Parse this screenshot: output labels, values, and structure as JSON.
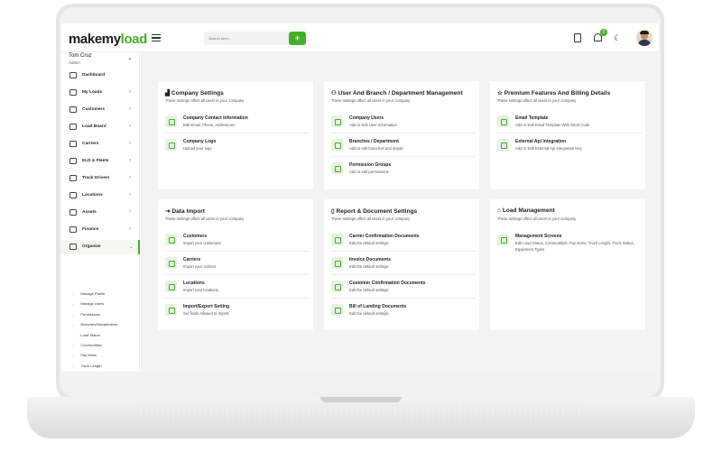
{
  "topbar": {
    "logo_main": "makemy",
    "logo_accent": "load",
    "search_placeholder": "Search here...",
    "search_button": "+",
    "notification_count": "0"
  },
  "user": {
    "name": "Tom Cruz",
    "role": "Admin"
  },
  "nav": [
    {
      "label": "Dashboard",
      "icon": "dashboard-icon"
    },
    {
      "label": "My Loads",
      "icon": "truck-icon"
    },
    {
      "label": "Customers",
      "icon": "users-icon"
    },
    {
      "label": "Load Board",
      "icon": "chart-icon"
    },
    {
      "label": "Carriers",
      "icon": "truck-icon"
    },
    {
      "label": "ELD & Fleets",
      "icon": "fleet-icon"
    },
    {
      "label": "Track Drivers",
      "icon": "pin-icon"
    },
    {
      "label": "Locations",
      "icon": "location-icon"
    },
    {
      "label": "Assets",
      "icon": "box-icon"
    },
    {
      "label": "Finance",
      "icon": "finance-icon"
    },
    {
      "label": "Organize",
      "icon": "gear-icon"
    }
  ],
  "subnav": [
    "Manage Profile",
    "Manage Users",
    "Permissions",
    "Branches/Departments",
    "Load Status",
    "Commodities",
    "Pay Items",
    "Truck Length",
    "Truck Status",
    "Equipment Types"
  ],
  "cards": [
    {
      "title": "Company Settings",
      "subtitle": "These settings affect all users in your company",
      "rows": [
        {
          "title": "Company Contact Information",
          "desc": "Edit Email, Phone, Address etc."
        },
        {
          "title": "Company Logo",
          "desc": "Upload your logo"
        }
      ]
    },
    {
      "title": "User And Branch / Department Management",
      "subtitle": "These settings affect all users in your company",
      "rows": [
        {
          "title": "Company Users",
          "desc": "Add or Edit User Information"
        },
        {
          "title": "Branches / Department",
          "desc": "Add or edit branches and depatt"
        },
        {
          "title": "Permission Groups",
          "desc": "Add or edit permissions"
        }
      ]
    },
    {
      "title": "Premium Features And Billing Details",
      "subtitle": "These settings affect all users in your company",
      "rows": [
        {
          "title": "Email Template",
          "desc": "Add or Edit Email Template With Short Code"
        },
        {
          "title": "External Api Integration",
          "desc": "Add or Edit External Api Integration Key"
        }
      ]
    },
    {
      "title": "Data Import",
      "subtitle": "These settings affect all users in your company",
      "rows": [
        {
          "title": "Customers",
          "desc": "Import your customers"
        },
        {
          "title": "Carriers",
          "desc": "Import your carriers"
        },
        {
          "title": "Locations",
          "desc": "Import your locations"
        },
        {
          "title": "Import/Export Setting",
          "desc": "Set fields Allowed to Import"
        }
      ]
    },
    {
      "title": "Report & Document Settings",
      "subtitle": "These settings affect all users in your company",
      "rows": [
        {
          "title": "Carrier Confirmation Documents",
          "desc": "Edit the default settings"
        },
        {
          "title": "Invoice Documents",
          "desc": "Edit the default settings"
        },
        {
          "title": "Customer Confirmation Documents",
          "desc": "Edit the default settings"
        },
        {
          "title": "Bill of Landing Documents",
          "desc": "Edit the default settings"
        }
      ]
    },
    {
      "title": "Load Management",
      "subtitle": "These settings affect all users in your company",
      "rows": [
        {
          "title": "Management Screens",
          "desc": "Edit Load Status, Commodities, Pay Items, Truck Length, Truck Status, Equipment Types"
        }
      ]
    }
  ]
}
